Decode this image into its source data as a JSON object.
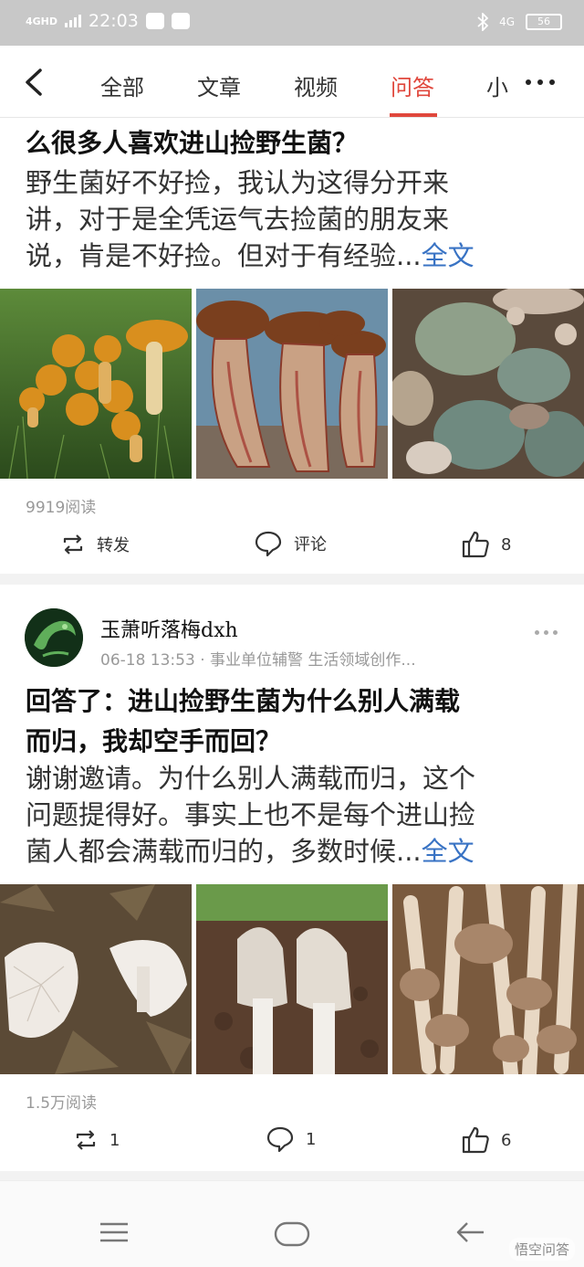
{
  "status_bar": {
    "network": "4GHD",
    "time": "22:03",
    "right_network": "4G",
    "battery": "56"
  },
  "nav": {
    "tabs": [
      "全部",
      "文章",
      "视频",
      "问答",
      "小"
    ],
    "active_tab": "问答",
    "accent_color": "#e0473c"
  },
  "post1": {
    "title_fragment": "么很多人喜欢进山捡野生菌？",
    "excerpt_lines": [
      "野生菌好不好捡，我认为这得分开来",
      "讲，对于是全凭运气去捡菌的朋友来"
    ],
    "excerpt_last": "说，肯是不好捡。但对于有经验...",
    "full_text_link": "全文",
    "reads": "9919阅读",
    "repost_label": "转发",
    "comment_label": "评论",
    "likes": "8"
  },
  "post2": {
    "author": "玉萧听落梅dxh",
    "meta": "06-18 13:53 · 事业单位辅警 生活领域创作...",
    "title_line1": "回答了：进山捡野生菌为什么别人满载",
    "title_line2": "而归，我却空手而回？",
    "excerpt_lines": [
      "谢谢邀请。为什么别人满载而归，这个",
      "问题提得好。事实上也不是每个进山捡"
    ],
    "excerpt_last": "菌人都会满载而归的，多数时候...",
    "full_text_link": "全文",
    "reads": "1.5万阅读",
    "reposts": "1",
    "comments": "1",
    "likes": "6"
  },
  "watermark": "悟空问答",
  "icons": [
    "back-chevron-icon",
    "more-dots-icon",
    "repost-icon",
    "comment-icon",
    "thumbs-up-icon",
    "menu-icon",
    "home-icon",
    "back-arrow-icon"
  ]
}
